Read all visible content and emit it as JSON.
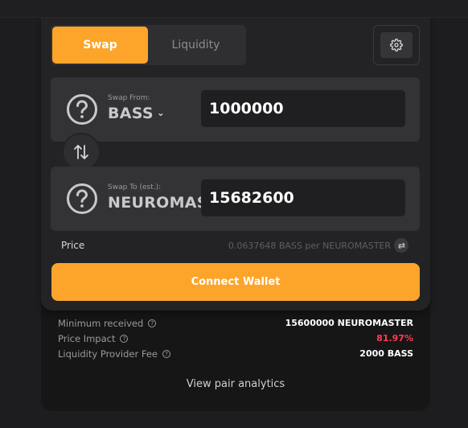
{
  "tabs": [
    {
      "label": "Swap",
      "active": true
    },
    {
      "label": "Liquidity",
      "active": false
    }
  ],
  "settings": {
    "icon": "gear-icon"
  },
  "from": {
    "label": "Swap From:",
    "token": "BASS",
    "token_icon": "question-circle-icon",
    "amount": "1000000"
  },
  "to": {
    "label": "Swap To (est.):",
    "token": "NEUROMASTER",
    "token_icon": "question-circle-icon",
    "amount": "15682600"
  },
  "price": {
    "label": "Price",
    "value": "0.0637648 BASS per NEUROMASTER"
  },
  "connect_wallet": "Connect Wallet",
  "details": [
    {
      "label": "Minimum received",
      "value": "15600000 NEUROMASTER"
    },
    {
      "label": "Price Impact",
      "value": "81.97%"
    },
    {
      "label": "Liquidity Provider Fee",
      "value": "2000 BASS"
    }
  ],
  "analytics_link": "View pair analytics",
  "colors": {
    "accent": "#fda52b",
    "danger": "#ff3b4e",
    "background": "#1d1d1f",
    "card": "#232325"
  }
}
